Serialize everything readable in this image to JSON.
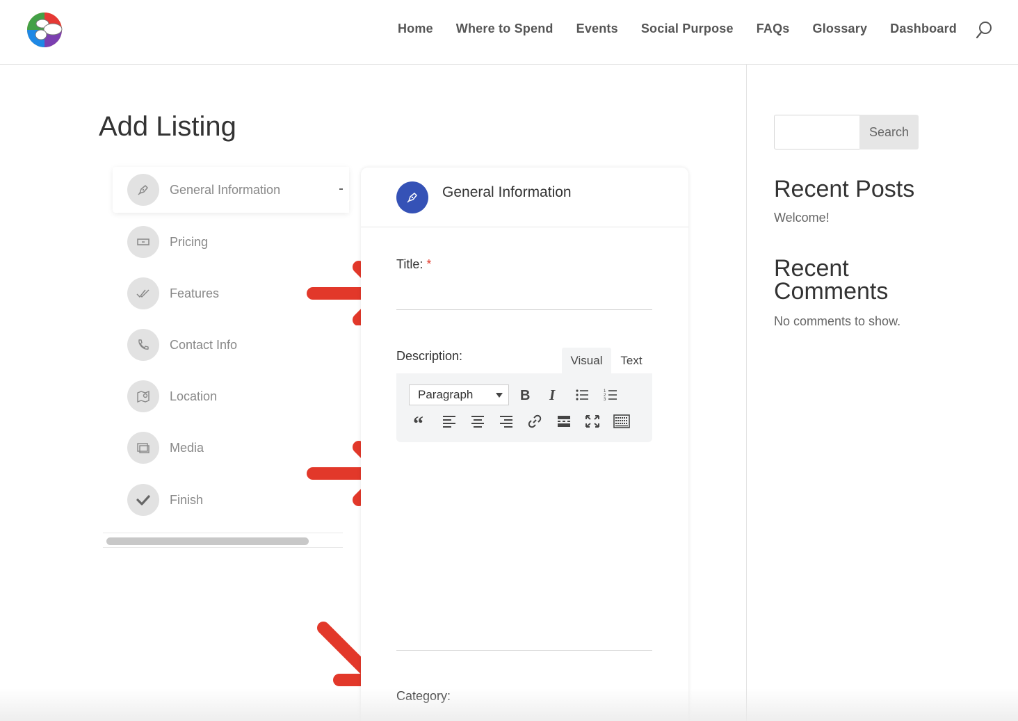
{
  "nav": {
    "items": [
      "Home",
      "Where to Spend",
      "Events",
      "Social Purpose",
      "FAQs",
      "Glossary",
      "Dashboard"
    ]
  },
  "page": {
    "title": "Add Listing"
  },
  "steps": [
    {
      "label": "General Information",
      "icon": "pen-icon",
      "active": true
    },
    {
      "label": "Pricing",
      "icon": "money-icon"
    },
    {
      "label": "Features",
      "icon": "checkmarks-icon"
    },
    {
      "label": "Contact Info",
      "icon": "phone-icon"
    },
    {
      "label": "Location",
      "icon": "map-icon"
    },
    {
      "label": "Media",
      "icon": "gallery-icon"
    },
    {
      "label": "Finish",
      "icon": "check-icon"
    }
  ],
  "form": {
    "section_title": "General Information",
    "title_label": "Title:",
    "required_mark": "*",
    "title_value": "",
    "description_label": "Description:",
    "tab_visual": "Visual",
    "tab_text": "Text",
    "format_select": "Paragraph",
    "category_label": "Category:"
  },
  "sidebar": {
    "search_button": "Search",
    "recent_posts_heading": "Recent Posts",
    "recent_posts": [
      "Welcome!"
    ],
    "recent_comments_heading_1": "Recent",
    "recent_comments_heading_2": "Comments",
    "no_comments": "No comments to show."
  },
  "colors": {
    "accent": "#3552b6",
    "annotation_arrow": "#e2382a",
    "required": "#e2382a"
  }
}
